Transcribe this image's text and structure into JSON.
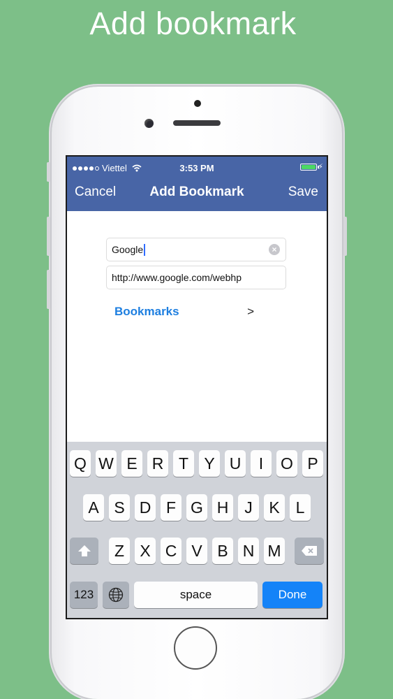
{
  "headline": "Add bookmark",
  "status_bar": {
    "carrier": "Viettel",
    "time": "3:53 PM",
    "signal_icon": "signal-dots-icon",
    "wifi_icon": "wifi-icon",
    "battery_icon": "battery-icon",
    "battery_level": 1.0
  },
  "nav": {
    "cancel_label": "Cancel",
    "title": "Add Bookmark",
    "save_label": "Save"
  },
  "form": {
    "name_value": "Google",
    "url_value": "http://www.google.com/webhp",
    "folder_label": "Bookmarks",
    "folder_arrow": ">"
  },
  "keyboard": {
    "row1": [
      "Q",
      "W",
      "E",
      "R",
      "T",
      "Y",
      "U",
      "I",
      "O",
      "P"
    ],
    "row2": [
      "A",
      "S",
      "D",
      "F",
      "G",
      "H",
      "J",
      "K",
      "L"
    ],
    "row3": [
      "Z",
      "X",
      "C",
      "V",
      "B",
      "N",
      "M"
    ],
    "numbers_label": "123",
    "space_label": "space",
    "done_label": "Done"
  },
  "colors": {
    "background": "#7dbf88",
    "nav_bar": "#4865a6",
    "link": "#1e7fe0",
    "done_key": "#1483f8"
  }
}
